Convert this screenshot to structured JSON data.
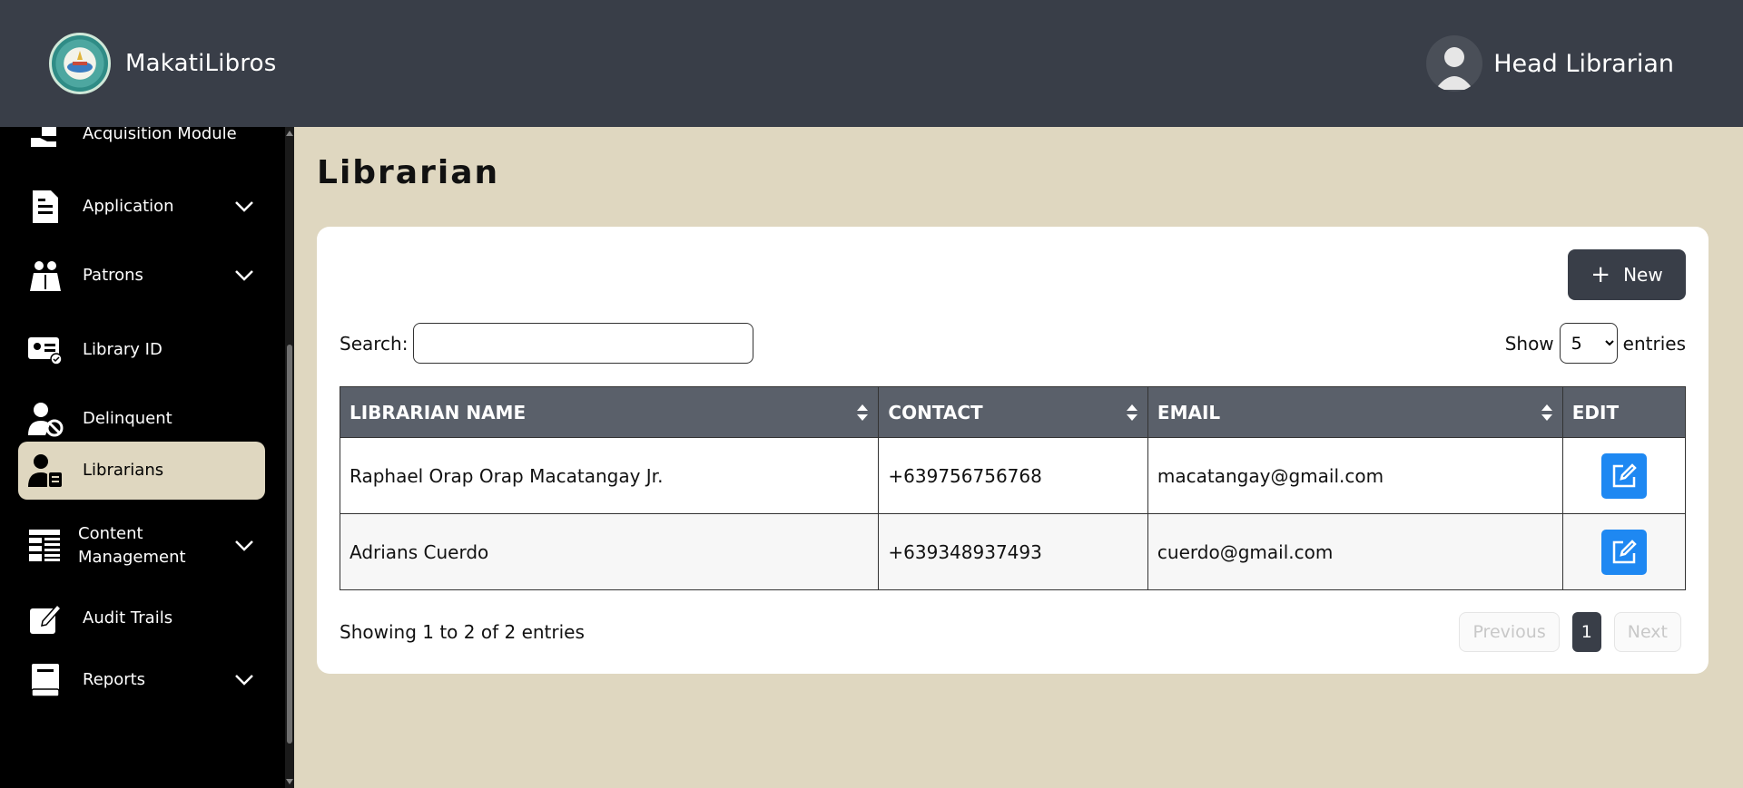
{
  "header": {
    "app_name": "MakatiLibros",
    "user_name": "Head Librarian"
  },
  "sidebar": {
    "items": [
      {
        "label": "Acquisition Module",
        "icon": "hand-box-icon",
        "dropdown": false
      },
      {
        "label": "Application",
        "icon": "document-icon",
        "dropdown": true
      },
      {
        "label": "Patrons",
        "icon": "reader-icon",
        "dropdown": true
      },
      {
        "label": "Library ID",
        "icon": "id-card-icon",
        "dropdown": false
      },
      {
        "label": "Delinquent",
        "icon": "user-ban-icon",
        "dropdown": false
      },
      {
        "label": "Librarians",
        "icon": "user-badge-icon",
        "dropdown": false,
        "active": true
      },
      {
        "label": "Content Management",
        "icon": "layout-icon",
        "dropdown": true
      },
      {
        "label": "Audit Trails",
        "icon": "edit-note-icon",
        "dropdown": false
      },
      {
        "label": "Reports",
        "icon": "book-icon",
        "dropdown": true
      }
    ]
  },
  "main": {
    "title": "Librarian",
    "new_button": "New",
    "search_label": "Search:",
    "search_value": "",
    "show_label": "Show",
    "show_value": "5",
    "entries_label": "entries",
    "table": {
      "columns": [
        "LIBRARIAN NAME",
        "CONTACT",
        "EMAIL",
        "EDIT"
      ],
      "rows": [
        {
          "name": "Raphael Orap Orap Macatangay Jr.",
          "contact": "+639756756768",
          "email": "macatangay@gmail.com"
        },
        {
          "name": "Adrians Cuerdo",
          "contact": "+639348937493",
          "email": "cuerdo@gmail.com"
        }
      ]
    },
    "info": "Showing 1 to 2 of 2 entries",
    "pagination": {
      "previous": "Previous",
      "page": "1",
      "next": "Next"
    }
  },
  "colors": {
    "topbar": "#393e48",
    "sidebar": "#000000",
    "background": "#dfd7c0",
    "table_header": "#5a606a",
    "edit_button": "#1e88f2"
  }
}
